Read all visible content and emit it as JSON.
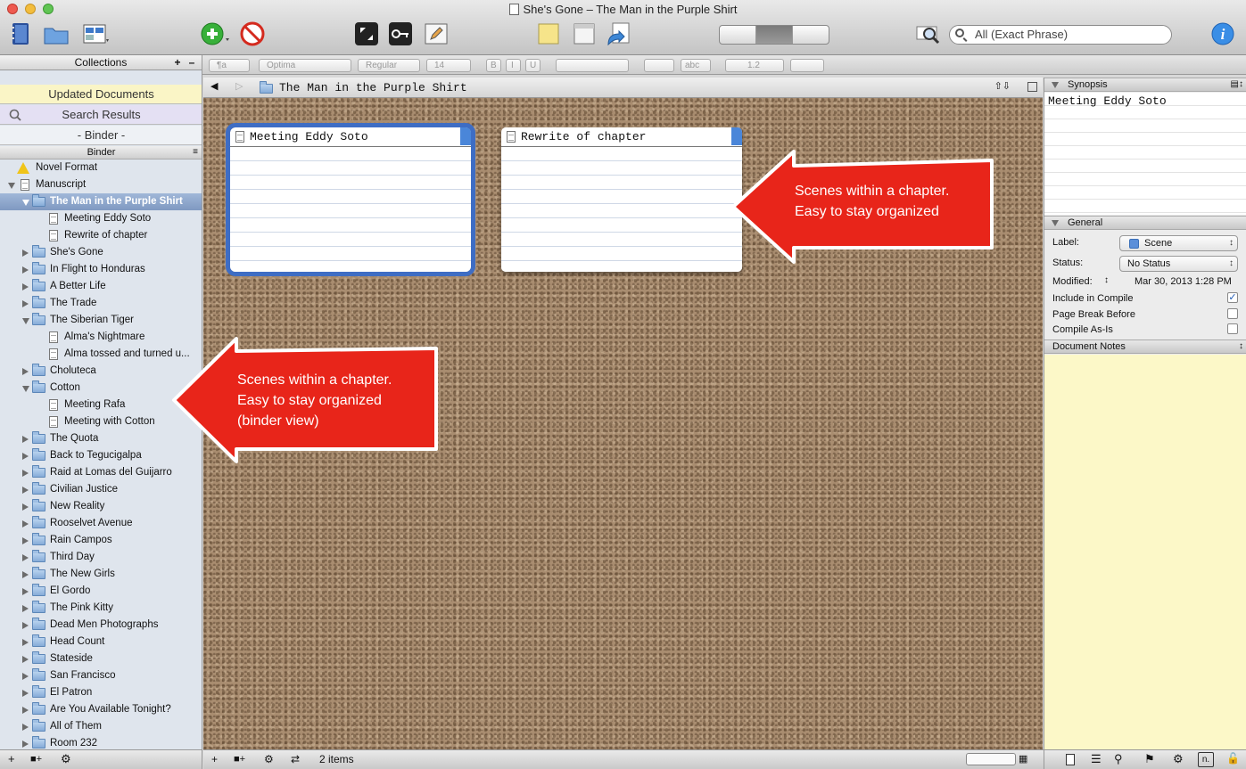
{
  "window": {
    "title": "She's Gone – The Man in the Purple Shirt"
  },
  "toolbar": {
    "search_placeholder": "All (Exact Phrase)",
    "info_label": "i"
  },
  "formatbar": {
    "style_label": "¶a",
    "font": "Optima",
    "weight": "Regular",
    "size": "14",
    "bold": "B",
    "italic": "I",
    "underline": "U",
    "highlight": "abc",
    "line_spacing": "1.2"
  },
  "collections": {
    "header": "Collections",
    "plus": "+",
    "minus": "–",
    "items": [
      "Updated Documents",
      "Search Results",
      "- Binder -"
    ]
  },
  "binder": {
    "title": "Binder",
    "items": [
      {
        "label": "Novel Format",
        "type": "warn",
        "level": 0,
        "state": "none"
      },
      {
        "label": "Manuscript",
        "type": "page",
        "level": 0,
        "state": "open"
      },
      {
        "label": "The Man in the Purple Shirt",
        "type": "folder",
        "level": 1,
        "state": "open",
        "selected": true
      },
      {
        "label": "Meeting Eddy Soto",
        "type": "page",
        "level": 2,
        "state": "none"
      },
      {
        "label": "Rewrite of chapter",
        "type": "page",
        "level": 2,
        "state": "none"
      },
      {
        "label": "She's Gone",
        "type": "folder",
        "level": 1,
        "state": "closed"
      },
      {
        "label": "In Flight to Honduras",
        "type": "folder",
        "level": 1,
        "state": "closed"
      },
      {
        "label": "A Better Life",
        "type": "folder",
        "level": 1,
        "state": "closed"
      },
      {
        "label": "The Trade",
        "type": "folder",
        "level": 1,
        "state": "closed"
      },
      {
        "label": "The Siberian Tiger",
        "type": "folder",
        "level": 1,
        "state": "open"
      },
      {
        "label": "Alma's Nightmare",
        "type": "page",
        "level": 2,
        "state": "none"
      },
      {
        "label": "Alma tossed and turned u...",
        "type": "page",
        "level": 2,
        "state": "none"
      },
      {
        "label": "Choluteca",
        "type": "folder",
        "level": 1,
        "state": "closed"
      },
      {
        "label": "Cotton",
        "type": "folder",
        "level": 1,
        "state": "open"
      },
      {
        "label": "Meeting Rafa",
        "type": "page",
        "level": 2,
        "state": "none"
      },
      {
        "label": "Meeting with Cotton",
        "type": "page",
        "level": 2,
        "state": "none"
      },
      {
        "label": "The Quota",
        "type": "folder",
        "level": 1,
        "state": "closed"
      },
      {
        "label": "Back to Tegucigalpa",
        "type": "folder",
        "level": 1,
        "state": "closed"
      },
      {
        "label": "Raid at Lomas del Guijarro",
        "type": "folder",
        "level": 1,
        "state": "closed"
      },
      {
        "label": "Civilian Justice",
        "type": "folder",
        "level": 1,
        "state": "closed"
      },
      {
        "label": "New Reality",
        "type": "folder",
        "level": 1,
        "state": "closed"
      },
      {
        "label": "Rooselvet Avenue",
        "type": "folder",
        "level": 1,
        "state": "closed"
      },
      {
        "label": "Rain Campos",
        "type": "folder",
        "level": 1,
        "state": "closed"
      },
      {
        "label": "Third Day",
        "type": "folder",
        "level": 1,
        "state": "closed"
      },
      {
        "label": "The New Girls",
        "type": "folder",
        "level": 1,
        "state": "closed"
      },
      {
        "label": "El Gordo",
        "type": "folder",
        "level": 1,
        "state": "closed"
      },
      {
        "label": "The Pink Kitty",
        "type": "folder",
        "level": 1,
        "state": "closed"
      },
      {
        "label": "Dead Men Photographs",
        "type": "folder",
        "level": 1,
        "state": "closed"
      },
      {
        "label": "Head Count",
        "type": "folder",
        "level": 1,
        "state": "closed"
      },
      {
        "label": "Stateside",
        "type": "folder",
        "level": 1,
        "state": "closed"
      },
      {
        "label": "San Francisco",
        "type": "folder",
        "level": 1,
        "state": "closed"
      },
      {
        "label": "El Patron",
        "type": "folder",
        "level": 1,
        "state": "closed"
      },
      {
        "label": "Are You Available Tonight?",
        "type": "folder",
        "level": 1,
        "state": "closed"
      },
      {
        "label": "All of Them",
        "type": "folder",
        "level": 1,
        "state": "closed"
      },
      {
        "label": "Room 232",
        "type": "folder",
        "level": 1,
        "state": "closed"
      }
    ]
  },
  "editor": {
    "header_title": "The Man in the Purple Shirt",
    "cards": [
      {
        "title": "Meeting Eddy Soto",
        "selected": true
      },
      {
        "title": "Rewrite of chapter",
        "selected": false
      }
    ],
    "callout_right": {
      "line1": "Scenes within a chapter.",
      "line2": "Easy to stay organized"
    },
    "callout_left": {
      "line1": "Scenes within a chapter.",
      "line2": "Easy to stay organized",
      "line3": "(binder view)"
    },
    "status_count": "2 items"
  },
  "inspector": {
    "synopsis_header": "Synopsis",
    "synopsis_text": "Meeting Eddy Soto",
    "general_header": "General",
    "label_label": "Label:",
    "label_value": "Scene",
    "label_color": "#5b8fd9",
    "status_label": "Status:",
    "status_value": "No Status",
    "modified_label": "Modified:",
    "modified_value": "Mar 30, 2013 1:28 PM",
    "include_compile": "Include in Compile",
    "page_break": "Page Break Before",
    "compile_as_is": "Compile As-Is",
    "notes_header": "Document Notes",
    "notes_icon_label": "n."
  },
  "colors": {
    "accent": "#3e6dc4",
    "callout": "#e8251a",
    "notes_bg": "#fcf8c8"
  }
}
